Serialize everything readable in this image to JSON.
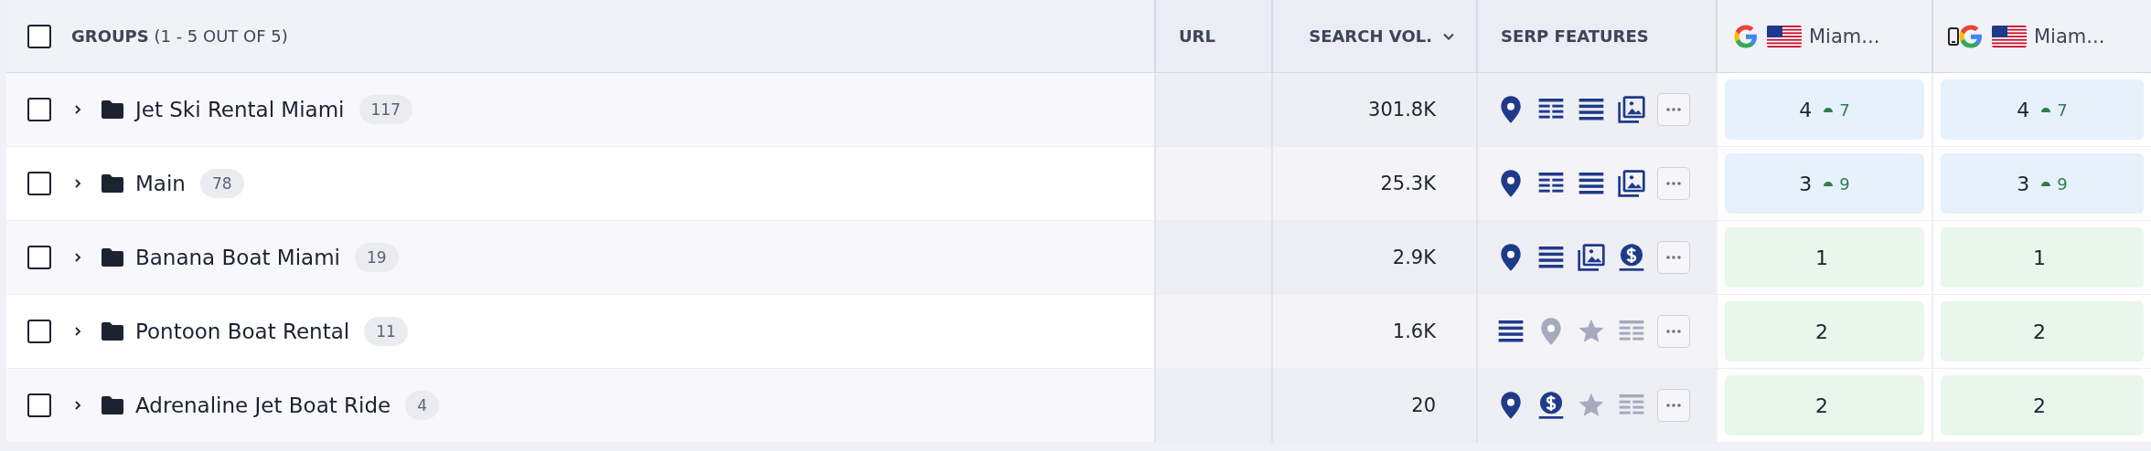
{
  "header": {
    "select_all": {
      "checked": false
    },
    "groups_label": "**GROUPS** (1 - 5 OUT OF 5)",
    "url_label": "URL",
    "search_volume_label": "SEARCH VOL.",
    "serp_features_label": "SERP FEATURES",
    "rank_columns": [
      {
        "kind": "desktop",
        "label": "Miam..."
      },
      {
        "kind": "mobile",
        "label": "Miam..."
      }
    ]
  },
  "rows": [
    {
      "checked": false,
      "expanded": false,
      "name": "Jet Ski Rental Miami",
      "count": "117",
      "search_volume": "301.8K",
      "features": [
        {
          "kind": "pin",
          "active": true
        },
        {
          "kind": "table",
          "active": true
        },
        {
          "kind": "list",
          "active": true
        },
        {
          "kind": "images",
          "active": true
        }
      ],
      "ranks": [
        {
          "value": "4",
          "change": "7",
          "color": "#e6f1fb"
        },
        {
          "value": "4",
          "change": "7",
          "color": "#e6f1fb"
        }
      ]
    },
    {
      "checked": false,
      "expanded": false,
      "name": "Main",
      "count": "78",
      "search_volume": "25.3K",
      "features": [
        {
          "kind": "pin",
          "active": true
        },
        {
          "kind": "table",
          "active": true
        },
        {
          "kind": "list",
          "active": true
        },
        {
          "kind": "images",
          "active": true
        }
      ],
      "ranks": [
        {
          "value": "3",
          "change": "9",
          "color": "#e6f1fb"
        },
        {
          "value": "3",
          "change": "9",
          "color": "#e6f1fb"
        }
      ]
    },
    {
      "checked": false,
      "expanded": false,
      "name": "Banana Boat Miami",
      "count": "19",
      "search_volume": "2.9K",
      "features": [
        {
          "kind": "pin",
          "active": true
        },
        {
          "kind": "list",
          "active": true
        },
        {
          "kind": "images",
          "active": true
        },
        {
          "kind": "dollar",
          "active": true
        }
      ],
      "ranks": [
        {
          "value": "1",
          "color": "#e8f6ec"
        },
        {
          "value": "1",
          "color": "#e8f6ec"
        }
      ]
    },
    {
      "checked": false,
      "expanded": false,
      "name": "Pontoon Boat Rental",
      "count": "11",
      "search_volume": "1.6K",
      "features": [
        {
          "kind": "list",
          "active": true
        },
        {
          "kind": "pin",
          "active": false
        },
        {
          "kind": "star",
          "active": false
        },
        {
          "kind": "table",
          "active": false
        }
      ],
      "ranks": [
        {
          "value": "2",
          "color": "#e8f6ec"
        },
        {
          "value": "2",
          "color": "#e8f6ec"
        }
      ]
    },
    {
      "checked": false,
      "expanded": false,
      "name": "Adrenaline Jet Boat Ride",
      "count": "4",
      "search_volume": "20",
      "features": [
        {
          "kind": "pin",
          "active": true
        },
        {
          "kind": "dollar",
          "active": true
        },
        {
          "kind": "star",
          "active": false
        },
        {
          "kind": "table",
          "active": false
        }
      ],
      "ranks": [
        {
          "value": "2",
          "color": "#e8f6ec"
        },
        {
          "value": "2",
          "color": "#e8f6ec"
        }
      ]
    }
  ]
}
